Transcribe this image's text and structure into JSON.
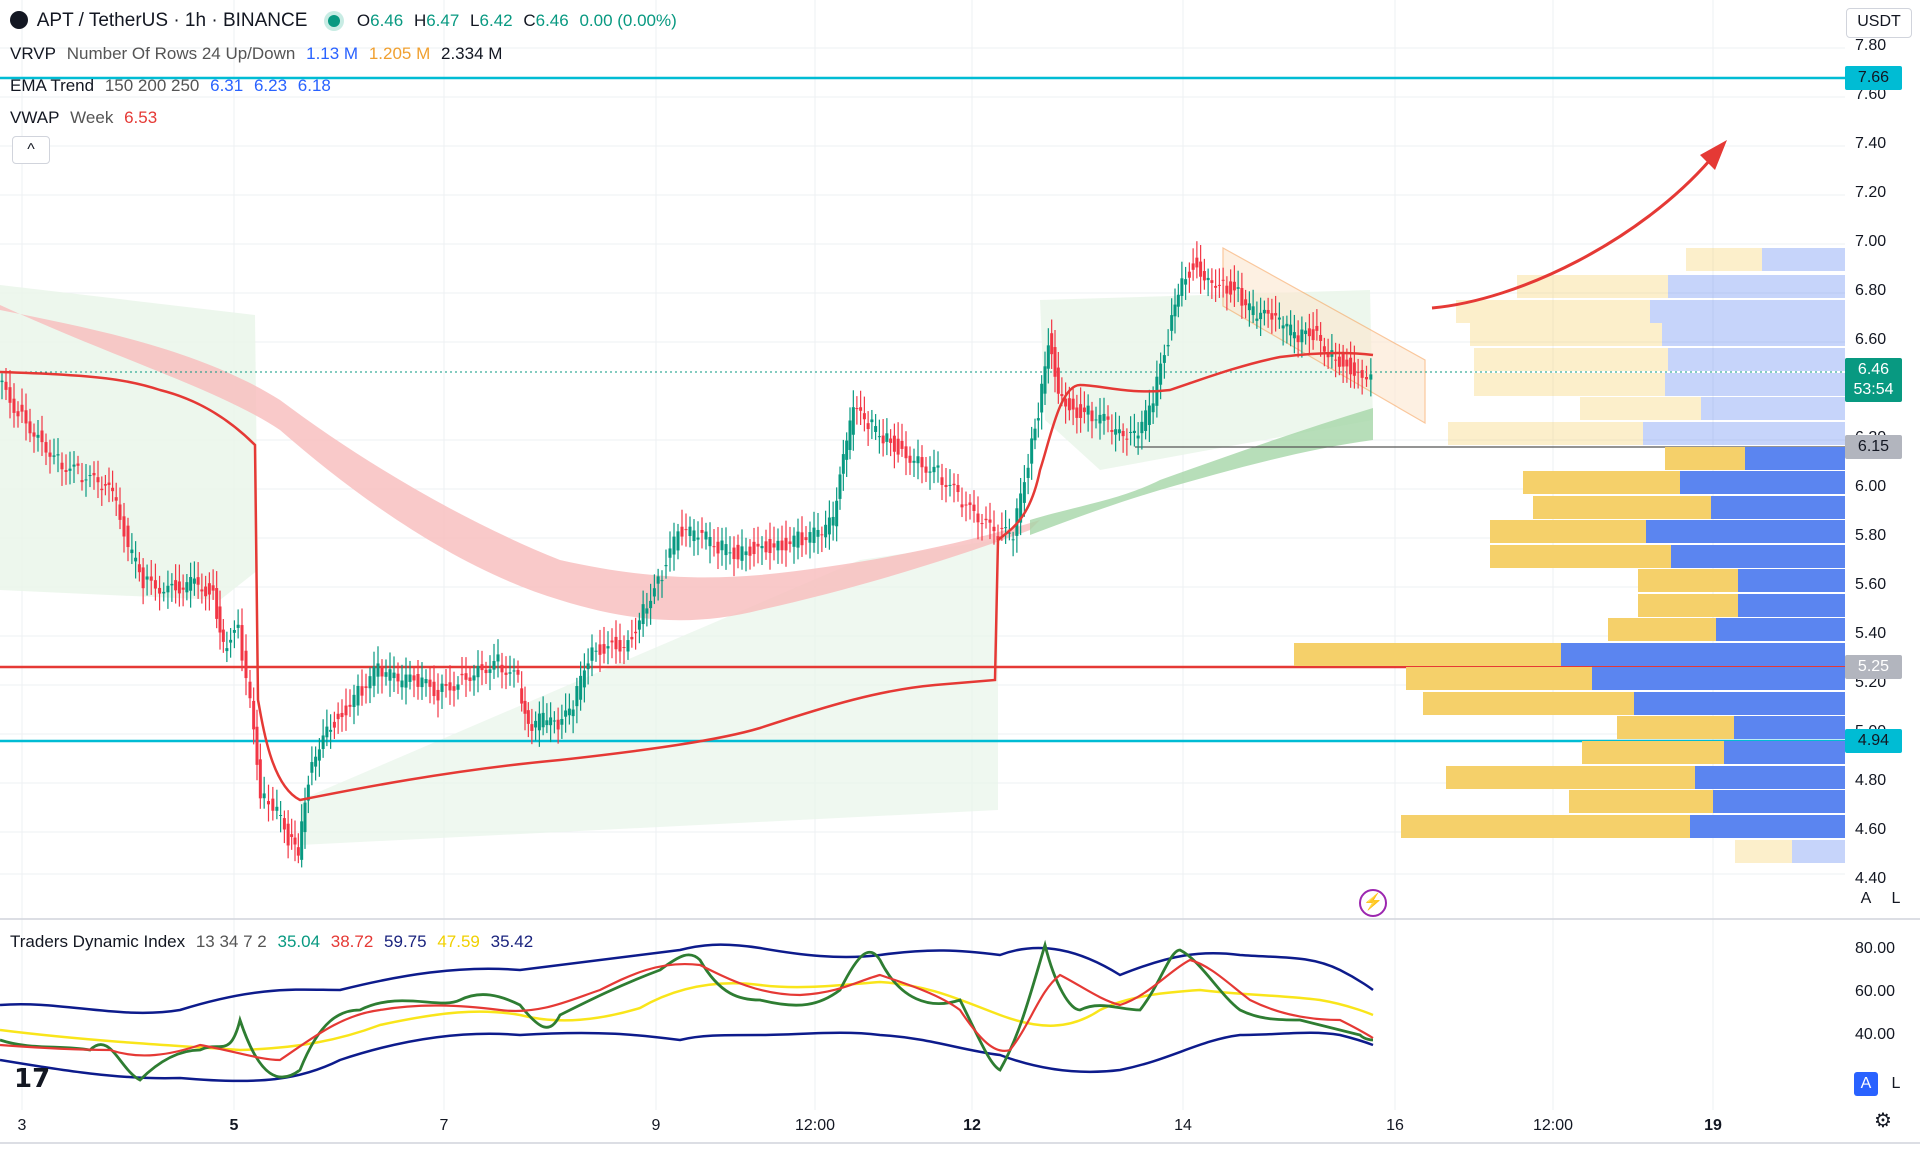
{
  "header": {
    "symbol": "APT / TetherUS · 1h · BINANCE",
    "open_label": "O",
    "open": "6.46",
    "high_label": "H",
    "high": "6.47",
    "low_label": "L",
    "low": "6.42",
    "close_label": "C",
    "close": "6.46",
    "change": "0.00 (0.00%)"
  },
  "indicators": {
    "vrvp": {
      "name": "VRVP",
      "params": "Number Of Rows 24 Up/Down",
      "v1": "1.13 M",
      "v2": "1.205 M",
      "v3": "2.334 M"
    },
    "ema": {
      "name": "EMA Trend",
      "params": "150 200 250",
      "v1": "6.31",
      "v2": "6.23",
      "v3": "6.18"
    },
    "vwap": {
      "name": "VWAP",
      "params": "Week",
      "v1": "6.53"
    },
    "tdi": {
      "name": "Traders Dynamic Index",
      "params": "13 34 7 2",
      "v1": "35.04",
      "v2": "38.72",
      "v3": "59.75",
      "v4": "47.59",
      "v5": "35.42"
    }
  },
  "controls": {
    "currency": "USDT",
    "collapse": "^",
    "auto": "A",
    "log": "L",
    "auto2": "A",
    "log2": "L"
  },
  "price_axis": [
    "7.80",
    "7.60",
    "7.40",
    "7.20",
    "7.00",
    "6.80",
    "6.60",
    "6.20",
    "6.00",
    "5.80",
    "5.60",
    "5.40",
    "5.20",
    "5.00",
    "4.80",
    "4.60",
    "4.40"
  ],
  "price_tags": {
    "top_line": "7.66",
    "current": "6.46",
    "countdown": "53:54",
    "support": "6.15",
    "red_line": "5.25",
    "bottom_line": "4.94"
  },
  "tdi_axis": [
    "80.00",
    "60.00",
    "40.00"
  ],
  "time_axis": [
    "3",
    "5",
    "7",
    "9",
    "12:00",
    "12",
    "14",
    "16",
    "12:00",
    "19"
  ],
  "colors": {
    "cyan_line": "#00bcd4",
    "red_line": "#e53935",
    "up_candle": "#089981",
    "down_candle": "#f23645",
    "vol_up": "#5b85f0",
    "vol_down": "#f5d06a",
    "current_price": "#089981"
  }
}
